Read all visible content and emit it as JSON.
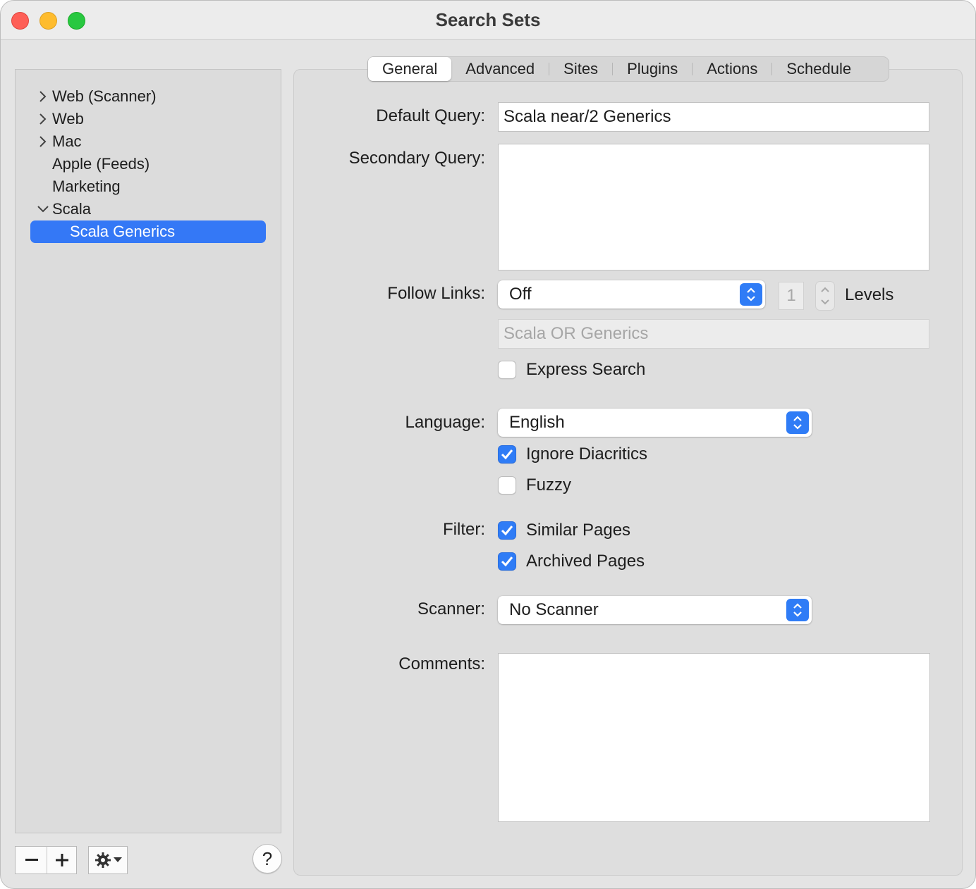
{
  "window": {
    "title": "Search Sets",
    "colors": {
      "accent": "#3478f6",
      "close": "#fe5f57",
      "minimize": "#febc2e",
      "maximize": "#28c840"
    }
  },
  "sidebar": {
    "items": [
      {
        "label": "Web (Scanner)",
        "disclosure": "collapsed"
      },
      {
        "label": "Web",
        "disclosure": "collapsed"
      },
      {
        "label": "Mac",
        "disclosure": "collapsed"
      },
      {
        "label": "Apple (Feeds)",
        "disclosure": "none"
      },
      {
        "label": "Marketing",
        "disclosure": "none"
      },
      {
        "label": "Scala",
        "disclosure": "expanded"
      },
      {
        "label": "Scala Generics",
        "disclosure": "none",
        "selected": true
      }
    ],
    "buttons": {
      "remove": "−",
      "add": "+",
      "help": "?"
    },
    "icons": {
      "remove": "minus-icon",
      "add": "plus-icon",
      "actions": "gear-icon",
      "help": "question-mark-icon"
    }
  },
  "tabs": [
    {
      "label": "General",
      "active": true
    },
    {
      "label": "Advanced"
    },
    {
      "label": "Sites"
    },
    {
      "label": "Plugins"
    },
    {
      "label": "Actions"
    },
    {
      "label": "Schedule"
    }
  ],
  "form": {
    "default_query": {
      "label": "Default Query:",
      "value": "Scala near/2 Generics"
    },
    "secondary_query": {
      "label": "Secondary Query:",
      "value": ""
    },
    "follow_links": {
      "label": "Follow Links:",
      "value": "Off",
      "levels_value": "1",
      "levels_label": "Levels",
      "link_query_placeholder": "Scala OR Generics"
    },
    "express_search": {
      "label": "Express Search",
      "checked": false
    },
    "language": {
      "label": "Language:",
      "value": "English"
    },
    "ignore_diacritics": {
      "label": "Ignore Diacritics",
      "checked": true
    },
    "fuzzy": {
      "label": "Fuzzy",
      "checked": false
    },
    "filter": {
      "label": "Filter:",
      "similar_pages": {
        "label": "Similar Pages",
        "checked": true
      },
      "archived_pages": {
        "label": "Archived Pages",
        "checked": true
      }
    },
    "scanner": {
      "label": "Scanner:",
      "value": "No Scanner"
    },
    "comments": {
      "label": "Comments:",
      "value": ""
    }
  }
}
